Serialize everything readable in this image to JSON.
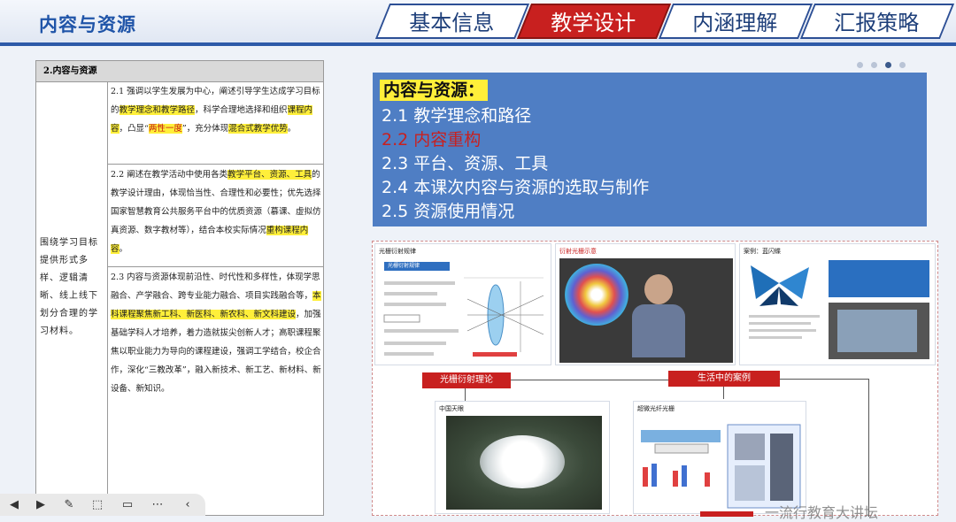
{
  "header": {
    "title": "内容与资源",
    "tabs": [
      {
        "label": "基本信息",
        "active": false
      },
      {
        "label": "教学设计",
        "active": true
      },
      {
        "label": "内涵理解",
        "active": false
      },
      {
        "label": "汇报策略",
        "active": false
      }
    ]
  },
  "pagination": {
    "total": 4,
    "current": 3
  },
  "doc": {
    "header": "2.内容与资源",
    "left_text": "围绕学习目标提供形式多样、逻辑清晰、线上线下划分合理的学习材料。",
    "sec1_a": "2.1 强调以学生发展为中心，阐述引导学生达成学习目标的",
    "sec1_h1": "教学理念和教学路径",
    "sec1_b": "，科学合理地选择和组织",
    "sec1_h2": "课程内容",
    "sec1_c": "，凸显“",
    "sec1_h3": "两性一度",
    "sec1_d": "”，充分体现",
    "sec1_h4": "混合式教学优势",
    "sec1_e": "。",
    "sec2_a": "2.2 阐述在教学活动中使用各类",
    "sec2_h1": "教学平台、资源、工具",
    "sec2_b": "的教学设计理由，体现恰当性、合理性和必要性；优先选择国家智慧教育公共服务平台中的优质资源（慕课、虚拟仿真资源、数字教材等），结合本校实际情况",
    "sec2_h2": "重构课程内容",
    "sec2_c": "。",
    "sec3_a": "2.3 内容与资源体现前沿性、时代性和多样性，体现学思融合、产学融合、跨专业能力融合、项目实践融合等，",
    "sec3_h1": "本科课程聚焦新工科、新医科、新农科、新文科建设",
    "sec3_b": "，加强基础学科人才培养，着力造就拔尖创新人才；高职课程聚焦以职业能力为导向的课程建设，强调工学结合，校企合作，深化“三教改革”，融入新技术、新工艺、新材料、新设备、新知识。"
  },
  "panel": {
    "title": "内容与资源：",
    "items": [
      {
        "label": "2.1 教学理念和路径",
        "current": false
      },
      {
        "label": "2.2 内容重构",
        "current": true
      },
      {
        "label": "2.3 平台、资源、工具",
        "current": false
      },
      {
        "label": "2.4 本课次内容与资源的选取与制作",
        "current": false
      },
      {
        "label": "2.5 资源使用情况",
        "current": false
      }
    ]
  },
  "collage": {
    "card1_title": "光栅衍射规律",
    "card1_sub": "光栅衍射规律",
    "card2_title": "衍射光栅示意",
    "card3_title": "案例：蓝闪蝶",
    "label_theory": "光栅衍射理论",
    "label_cases": "生活中的案例",
    "card4_title": "中国天眼",
    "card5_title": "超微光纤光栅"
  },
  "watermark": "一流行教育大讲坛",
  "colors": {
    "accent": "#c8201f",
    "brand": "#1f54a8",
    "panel": "#4f7ec4",
    "highlight": "#ffef3a"
  }
}
